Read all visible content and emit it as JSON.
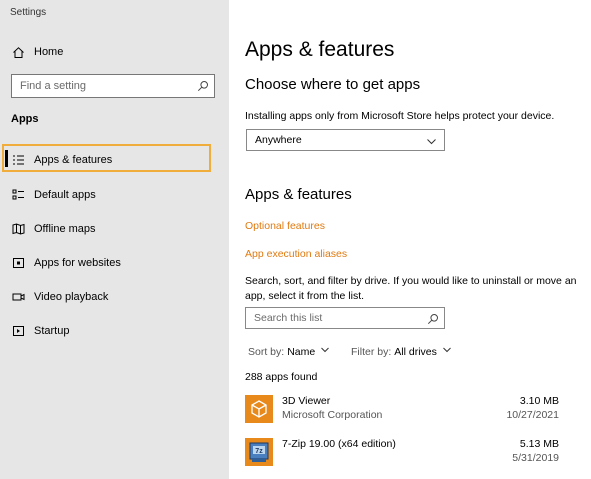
{
  "window": {
    "title": "Settings"
  },
  "sidebar": {
    "home_label": "Home",
    "search_placeholder": "Find a setting",
    "section_title": "Apps",
    "items": [
      {
        "label": "Apps & features",
        "icon": "list-icon",
        "selected": true
      },
      {
        "label": "Default apps",
        "icon": "default-apps-icon"
      },
      {
        "label": "Offline maps",
        "icon": "map-icon"
      },
      {
        "label": "Apps for websites",
        "icon": "web-app-icon"
      },
      {
        "label": "Video playback",
        "icon": "video-icon"
      },
      {
        "label": "Startup",
        "icon": "startup-icon"
      }
    ]
  },
  "main": {
    "title": "Apps & features",
    "choose_heading": "Choose where to get apps",
    "choose_desc": "Installing apps only from Microsoft Store helps protect your device.",
    "source_dropdown": {
      "value": "Anywhere"
    },
    "features_heading": "Apps & features",
    "optional_features_link": "Optional features",
    "execution_aliases_link": "App execution aliases",
    "search_desc_line1": "Search, sort, and filter by drive. If you would like to uninstall or move an",
    "search_desc_line2": "app, select it from the list.",
    "search_placeholder": "Search this list",
    "sort": {
      "label": "Sort by:",
      "value": "Name"
    },
    "filter": {
      "label": "Filter by:",
      "value": "All drives"
    },
    "count_text": "288 apps found",
    "apps": [
      {
        "name": "3D Viewer",
        "publisher": "Microsoft Corporation",
        "size": "3.10 MB",
        "date": "10/27/2021",
        "icon": "3d-viewer-icon"
      },
      {
        "name": "7-Zip 19.00 (x64 edition)",
        "publisher": "",
        "size": "5.13 MB",
        "date": "5/31/2019",
        "icon": "7zip-icon"
      }
    ]
  },
  "colors": {
    "accent": "#e07a10",
    "selection_border": "#f0ad3b",
    "sidebar_bg": "#e6e6e6",
    "app_tile": "#e8891c"
  }
}
